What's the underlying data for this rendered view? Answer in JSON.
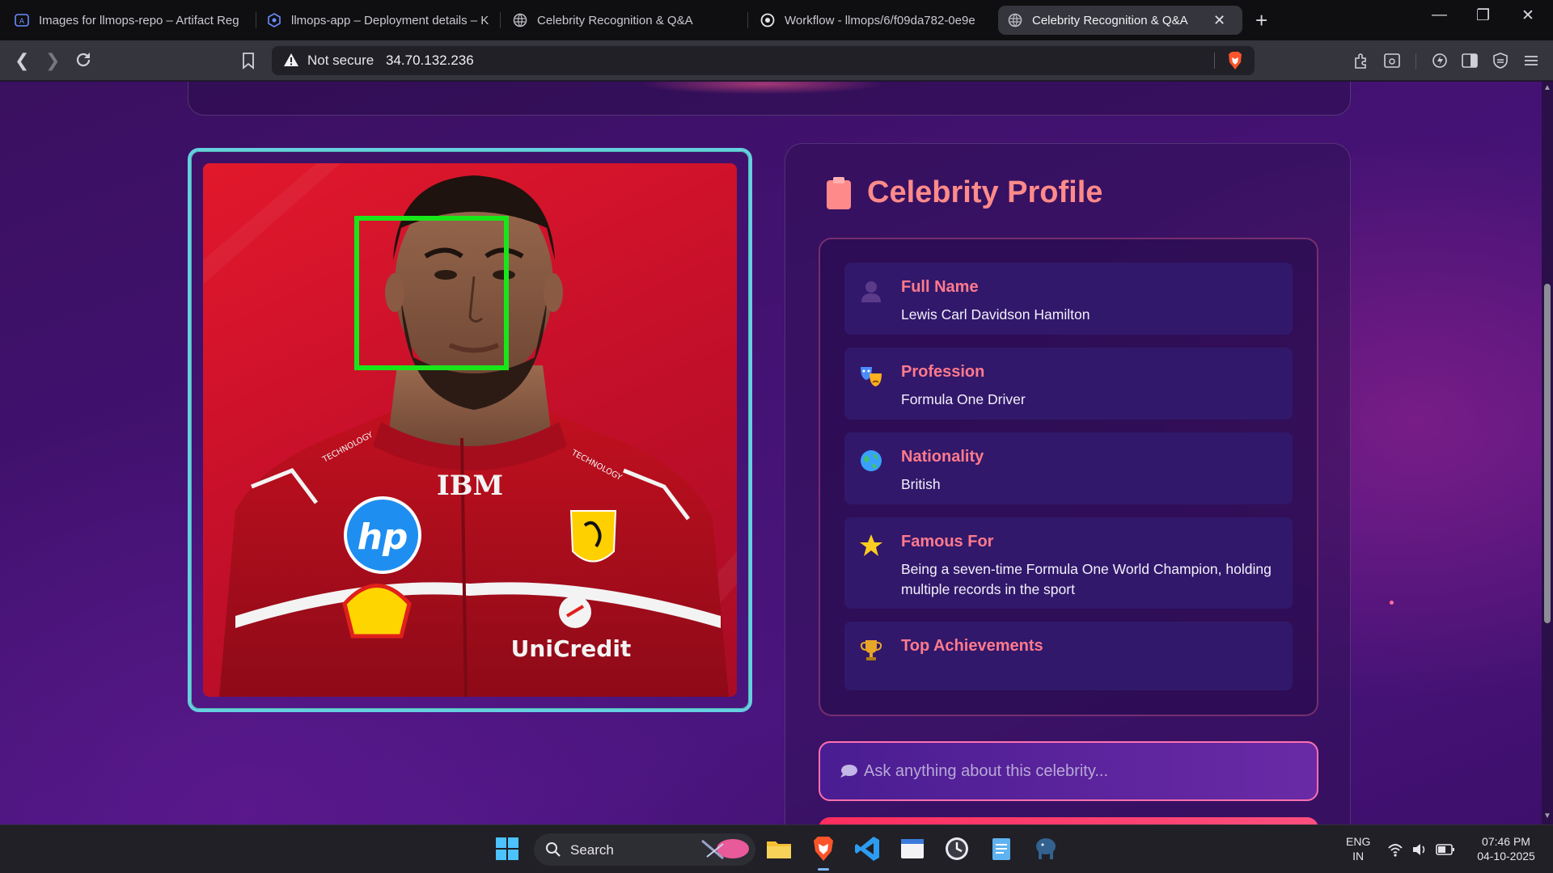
{
  "browser": {
    "tabs": [
      {
        "title": "Images for llmops-repo – Artifact Reg",
        "active": false
      },
      {
        "title": "llmops-app – Deployment details – K",
        "active": false
      },
      {
        "title": "Celebrity Recognition & Q&A",
        "active": false
      },
      {
        "title": "Workflow - llmops/6/f09da782-0e9e",
        "active": false
      },
      {
        "title": "Celebrity Recognition & Q&A",
        "active": true
      }
    ],
    "security_label": "Not secure",
    "url": "34.70.132.236"
  },
  "page": {
    "profile_title": "Celebrity Profile",
    "details": [
      {
        "icon": "person-icon",
        "label": "Full Name",
        "value": "Lewis Carl Davidson Hamilton"
      },
      {
        "icon": "theater-masks-icon",
        "label": "Profession",
        "value": "Formula One Driver"
      },
      {
        "icon": "globe-icon",
        "label": "Nationality",
        "value": "British"
      },
      {
        "icon": "star-icon",
        "label": "Famous For",
        "value": "Being a seven-time Formula One World Champion, holding multiple records in the sport"
      },
      {
        "icon": "trophy-icon",
        "label": "Top Achievements",
        "value": ""
      }
    ],
    "question_placeholder": "Ask anything about this celebrity...",
    "photo": {
      "jersey_text": "IBM",
      "sponsor_text": "UniCredit",
      "sleeve_text": "TECHNOLOGY",
      "face_box_color": "#19e619"
    }
  },
  "taskbar": {
    "search_label": "Search",
    "language": "ENG",
    "region": "IN",
    "time": "07:46 PM",
    "date": "04-10-2025"
  },
  "colors": {
    "accent_pink": "#ff7a8c",
    "frame_cyan": "#66cfe0",
    "card_bg": "#31186b"
  }
}
